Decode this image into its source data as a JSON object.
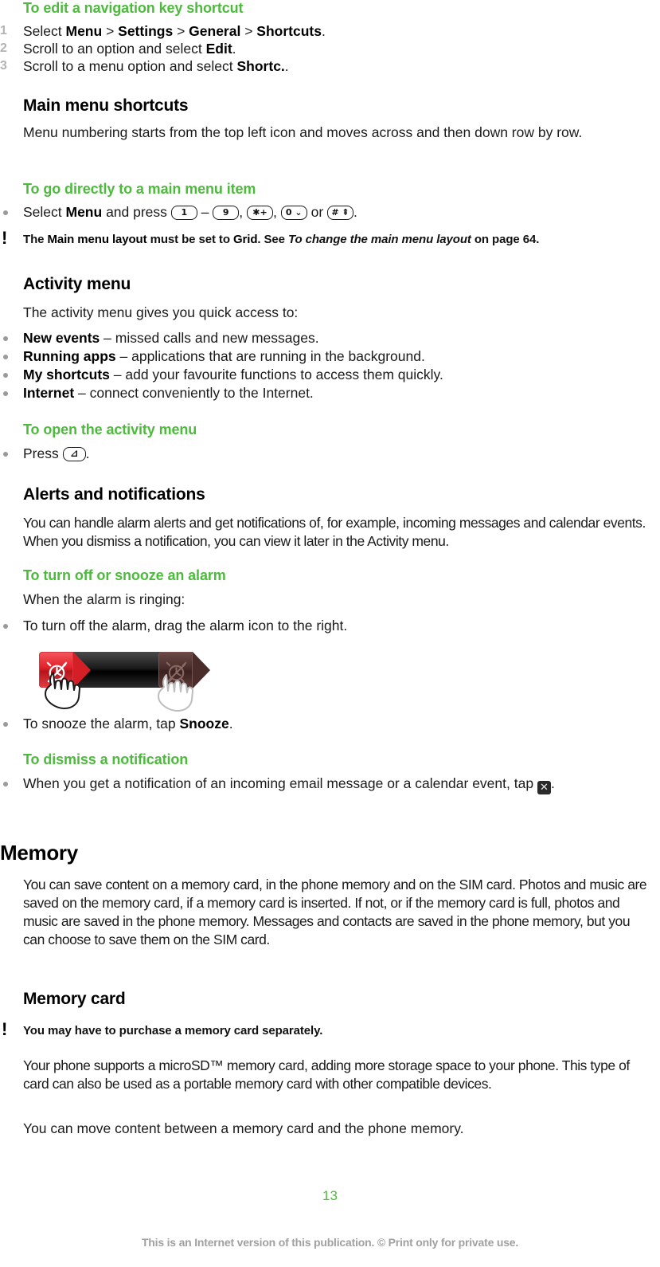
{
  "document": {
    "page_number": "13",
    "footer_note": "This is an Internet version of this publication. © Print only for private use.",
    "accent_green": "#4CBB3C",
    "body_color": "#1a1a1a",
    "marker_gray": "#9a9a9a"
  },
  "procedures": {
    "edit_nav_key": {
      "title": "To edit a navigation key shortcut",
      "steps": [
        {
          "num": "1",
          "text_parts": [
            "Select ",
            "Menu",
            " > ",
            "Settings",
            " > ",
            "General",
            " > ",
            "Shortcuts",
            "."
          ]
        },
        {
          "num": "2",
          "text_parts": [
            "Scroll to an option and select ",
            "Edit",
            "."
          ]
        },
        {
          "num": "3",
          "text_parts": [
            "Scroll to a menu option and select ",
            "Shortc.",
            "."
          ]
        }
      ]
    },
    "go_directly": {
      "title": "To go directly to a main menu item",
      "bullet_prefix": "Select ",
      "bullet_bold": "Menu",
      "bullet_mid": " and press ",
      "keys": [
        "1",
        "9",
        "✱+",
        "0 ⌄",
        "# ⇞"
      ],
      "key_names": [
        "key-1",
        "key-9",
        "key-star",
        "key-0",
        "key-hash"
      ],
      "separator_dash": " – ",
      "separator_comma": ", ",
      "separator_or": " or ",
      "end": "."
    },
    "open_activity": {
      "title": "To open the activity menu",
      "bullet_prefix": "Press ",
      "key": "⊿",
      "end": "."
    },
    "turn_off_snooze": {
      "title": "To turn off or snooze an alarm",
      "intro": "When the alarm is ringing:",
      "bullets": [
        {
          "text": "To turn off the alarm, drag the alarm icon to the right."
        },
        {
          "pre": "To snooze the alarm, tap ",
          "bold": "Snooze",
          "post": "."
        }
      ],
      "figure": {
        "name": "alarm-slider-illustration",
        "handle_color": "#e01f28",
        "track_color": "#000000",
        "target_color": "#4a2d2a",
        "handle_icon": "alarm-off-icon",
        "target_icon": "alarm-off-icon-faded",
        "cursor_icon": "hand-drag-cursor"
      }
    },
    "dismiss_notification": {
      "title": "To dismiss a notification",
      "bullet_pre": "When you get a notification of an incoming email message or a calendar event, tap ",
      "icon_glyph": "✕",
      "icon_name": "dismiss-x-icon",
      "bullet_post": "."
    }
  },
  "sections": {
    "main_menu_shortcuts": {
      "heading": "Main menu shortcuts",
      "body": "Menu numbering starts from the top left icon and moves across and then down row by row.",
      "note_parts": [
        "The ",
        "Main menu layout",
        " must be set to ",
        "Grid",
        ". See ",
        "To change the main menu layout",
        " on page 64."
      ]
    },
    "activity_menu": {
      "heading": "Activity menu",
      "body": "The activity menu gives you quick access to:",
      "items": [
        {
          "term": "New events",
          "desc": " – missed calls and new messages."
        },
        {
          "term": "Running apps",
          "desc": " – applications that are running in the background."
        },
        {
          "term": "My shortcuts",
          "desc": " – add your favourite functions to access them quickly."
        },
        {
          "term": "Internet",
          "desc": " – connect conveniently to the Internet."
        }
      ]
    },
    "alerts_notifications": {
      "heading": "Alerts and notifications",
      "body": "You can handle alarm alerts and get notifications of, for example, incoming messages and calendar events. When you dismiss a notification, you can view it later in the Activity menu."
    },
    "memory": {
      "heading": "Memory",
      "body": "You can save content on a memory card, in the phone memory and on the SIM card. Photos and music are saved on the memory card, if a memory card is inserted. If not, or if the memory card is full, photos and music are saved in the phone memory. Messages and contacts are saved in the phone memory, but you can choose to save them on the SIM card."
    },
    "memory_card": {
      "heading": "Memory card",
      "note": "You may have to purchase a memory card separately.",
      "body_1": "Your phone supports a microSD™ memory card, adding more storage space to your phone. This type of card can also be used as a portable memory card with other compatible devices.",
      "body_2": "You can move content between a memory card and the phone memory."
    }
  }
}
